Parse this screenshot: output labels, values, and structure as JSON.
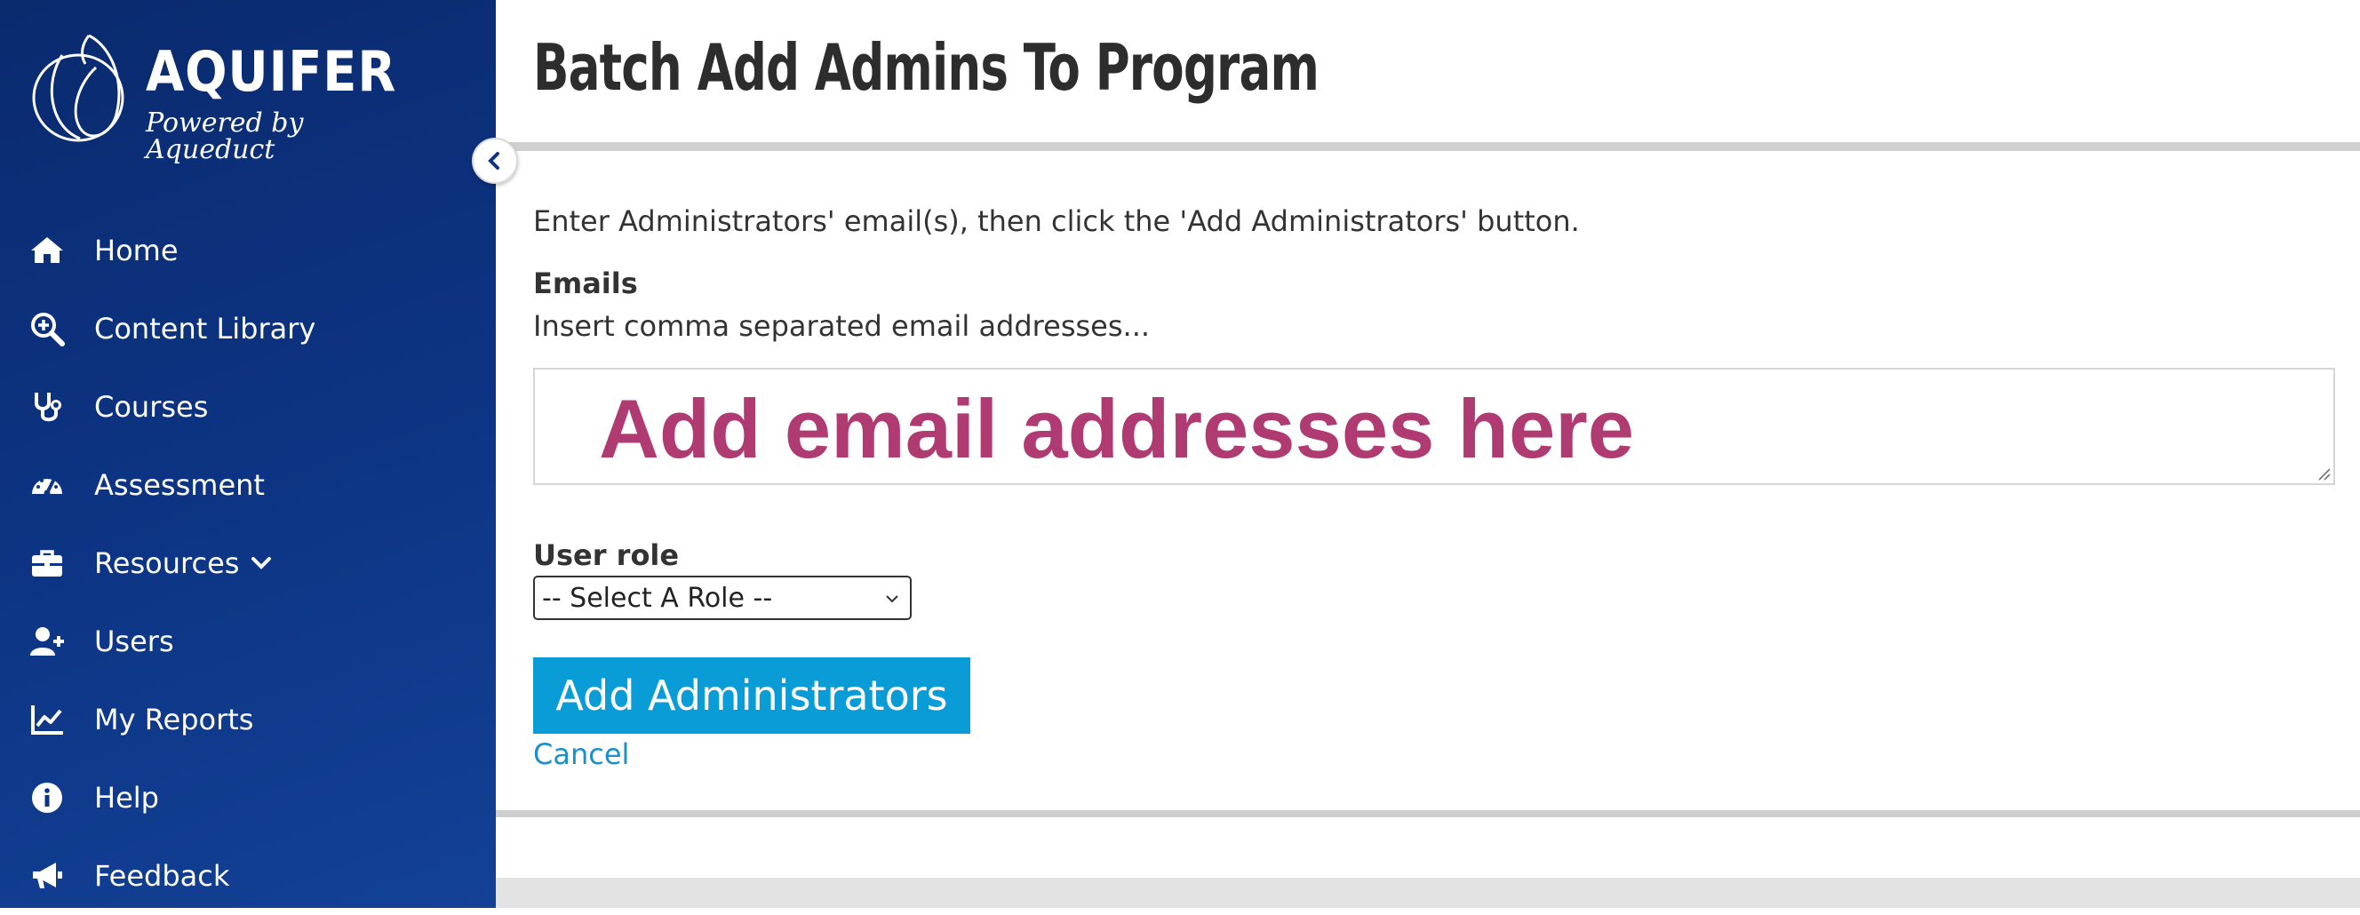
{
  "brand": {
    "name": "AQUIFER",
    "tagline": "Powered by Aqueduct",
    "sidebar_color": "#0d3585"
  },
  "sidebar": {
    "items": [
      {
        "label": "Home",
        "icon": "home-icon"
      },
      {
        "label": "Content Library",
        "icon": "search-plus-icon"
      },
      {
        "label": "Courses",
        "icon": "stethoscope-icon"
      },
      {
        "label": "Assessment",
        "icon": "gauge-icon"
      },
      {
        "label": "Resources",
        "icon": "briefcase-icon",
        "has_dropdown": true
      },
      {
        "label": "Users",
        "icon": "user-plus-icon"
      },
      {
        "label": "My Reports",
        "icon": "chart-line-icon"
      },
      {
        "label": "Help",
        "icon": "info-circle-icon"
      },
      {
        "label": "Feedback",
        "icon": "megaphone-icon"
      }
    ]
  },
  "header": {
    "title": "Batch Add Admins To Program"
  },
  "form": {
    "instructions": "Enter Administrators' email(s), then click the 'Add Administrators' button.",
    "emails_label": "Emails",
    "emails_hint": "Insert comma separated email addresses...",
    "emails_annotation": "Add email addresses here",
    "role_label": "User role",
    "role_selected": "-- Select A Role --",
    "submit_label": "Add Administrators",
    "cancel_label": "Cancel",
    "accent_color": "#0a9cd6",
    "annotation_color": "#b03a72"
  }
}
